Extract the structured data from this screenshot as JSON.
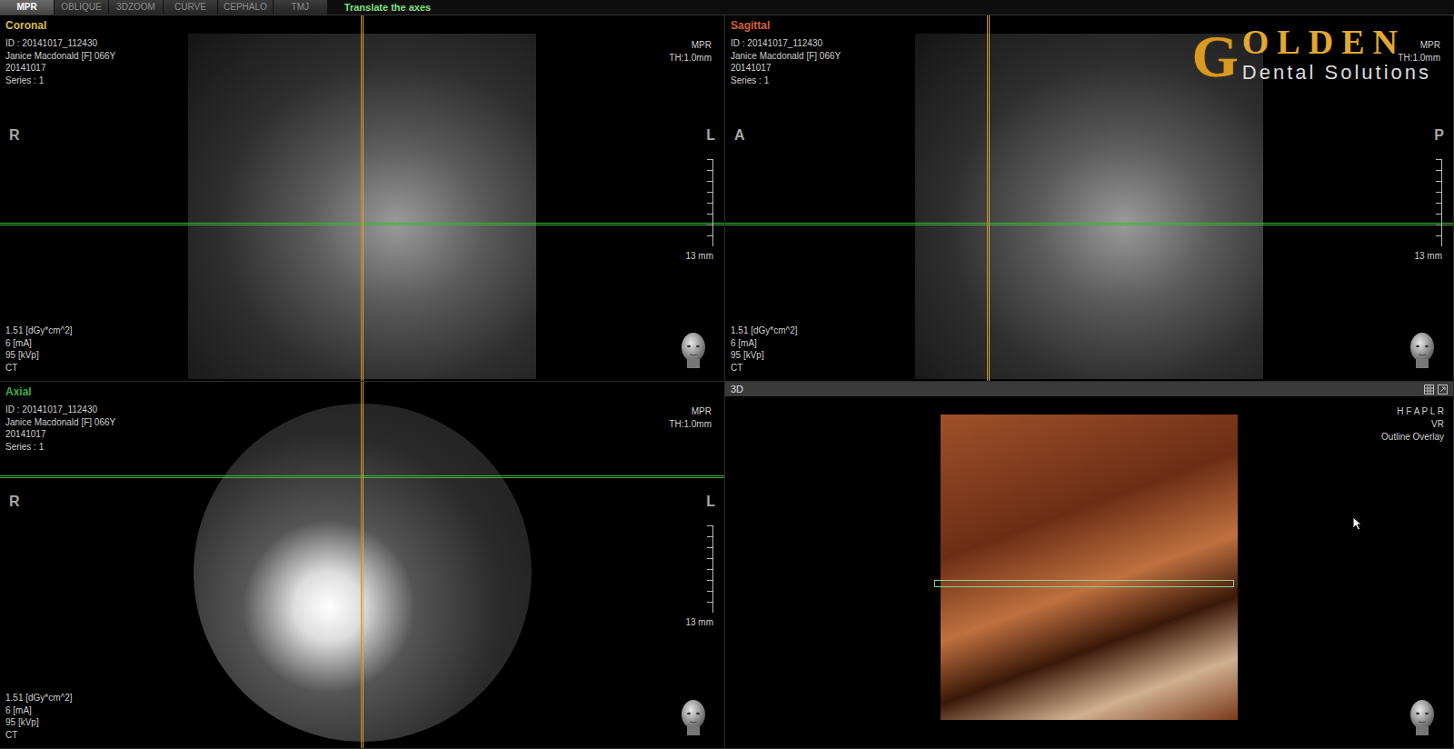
{
  "toolbar": {
    "tabs": [
      {
        "label": "MPR",
        "selected": true
      },
      {
        "label": "OBLIQUE",
        "selected": false
      },
      {
        "label": "3DZOOM",
        "selected": false
      },
      {
        "label": "CURVE",
        "selected": false
      },
      {
        "label": "CEPHALO",
        "selected": false
      },
      {
        "label": "TMJ",
        "selected": false
      }
    ],
    "hint": "Translate the axes"
  },
  "logo": {
    "initial": "G",
    "word": "OLDEN",
    "subtitle": "Dental Solutions"
  },
  "views": [
    {
      "title": "Coronal",
      "color": "#d9bb45",
      "kind": "rect",
      "info": [
        "ID : 20141017_112430",
        "Janice Macdonald [F] 066Y",
        "20141017",
        "Series : 1"
      ],
      "mode": "MPR",
      "thickness": "TH:1.0mm",
      "left": "R",
      "right": "L",
      "scale": "13 mm",
      "dose": [
        "1.51  [dGy*cm^2]",
        "6  [mA]",
        "95  [kVp]",
        "CT"
      ]
    },
    {
      "title": "Sagittal",
      "color": "#d8603e",
      "kind": "rect",
      "info": [
        "ID : 20141017_112430",
        "Janice Macdonald [F] 066Y",
        "20141017",
        "Series : 1"
      ],
      "mode": "MPR",
      "thickness": "TH:1.0mm",
      "left": "A",
      "right": "P",
      "scale": "13 mm",
      "dose": [
        "1.51  [dGy*cm^2]",
        "6  [mA]",
        "95  [kVp]",
        "CT"
      ]
    },
    {
      "title": "Axial",
      "color": "#3fae3f",
      "kind": "circle",
      "info": [
        "ID : 20141017_112430",
        "Janice Macdonald [F] 066Y",
        "20141017",
        "Series : 1"
      ],
      "mode": "MPR",
      "thickness": "TH:1.0mm",
      "left": "R",
      "right": "L",
      "scale": "13 mm",
      "dose": [
        "1.51  [dGy*cm^2]",
        "6  [mA]",
        "95  [kVp]",
        "CT"
      ]
    }
  ],
  "render3d": {
    "title": "3D",
    "orientation": "H F A P L R",
    "mode": "VR",
    "overlay": "Outline Overlay"
  }
}
